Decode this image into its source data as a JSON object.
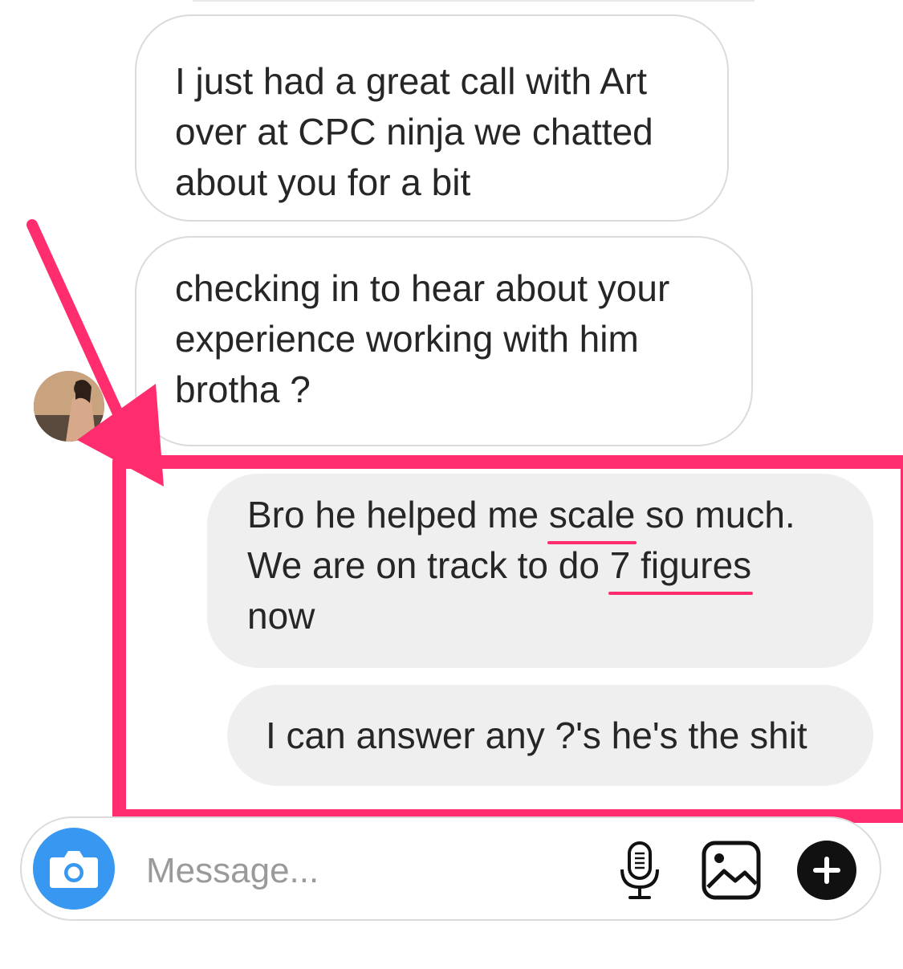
{
  "thread": {
    "messages": [
      {
        "direction": "incoming",
        "lines": [
          "I just had a great call with Art",
          "over at CPC ninja we chatted",
          "about you for a bit"
        ]
      },
      {
        "direction": "incoming",
        "lines": [
          "checking in to hear about your",
          "experience working with him",
          "brotha ?"
        ]
      },
      {
        "direction": "outgoing",
        "lines": {
          "l1_before": "Bro he helped me ",
          "l1_highlight": "scale",
          "l1_after": " so much.",
          "l2_before": "We are on track to do ",
          "l2_highlight": "7 figures",
          "l3": "now"
        }
      },
      {
        "direction": "outgoing",
        "lines": [
          "I can answer any ?'s he's the shit"
        ]
      }
    ],
    "avatar_icon": "profile-photo",
    "annotation_color": "#ff2d6e"
  },
  "composer": {
    "placeholder": "Message...",
    "value": "",
    "camera_icon": "camera-icon",
    "mic_icon": "microphone-icon",
    "gallery_icon": "image-gallery-icon",
    "plus_icon": "plus-icon",
    "camera_color": "#3897f0"
  }
}
